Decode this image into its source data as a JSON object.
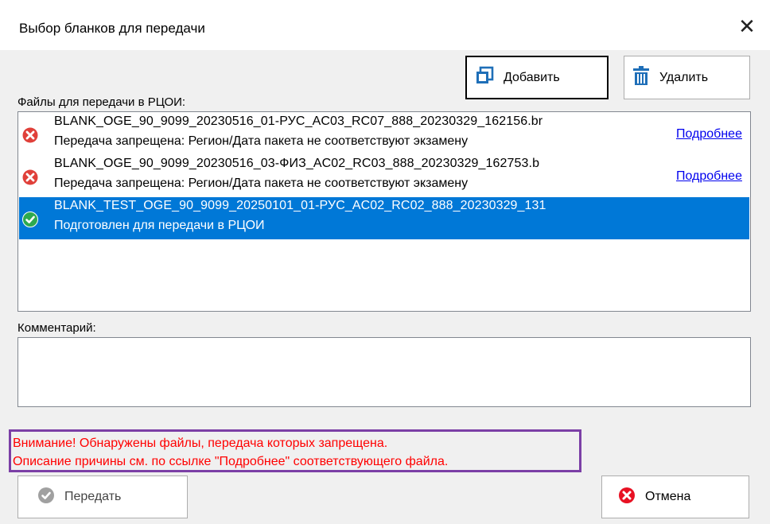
{
  "window": {
    "title": "Выбор бланков для передачи",
    "close_glyph": "✕"
  },
  "toolbar": {
    "add_label": "Добавить",
    "add_icon": "copy-icon",
    "delete_label": "Удалить",
    "delete_icon": "trash-icon"
  },
  "files": {
    "label": "Файлы для передачи в РЦОИ:",
    "items": [
      {
        "name": "BLANK_OGE_90_9099_20230516_01-РУС_AC03_RC07_888_20230329_162156.br",
        "status": "Передача запрещена: Регион/Дата пакета не соответствуют экзамену",
        "state": "error",
        "more_label": "Подробнее"
      },
      {
        "name": "BLANK_OGE_90_9099_20230516_03-ФИЗ_AC02_RC03_888_20230329_162753.b",
        "status": "Передача запрещена: Регион/Дата пакета не соответствуют экзамену",
        "state": "error",
        "more_label": "Подробнее"
      },
      {
        "name": "BLANK_TEST_OGE_90_9099_20250101_01-РУС_AC02_RC02_888_20230329_131",
        "status": "Подготовлен для передачи в РЦОИ",
        "state": "ok",
        "selected": true
      }
    ]
  },
  "comment": {
    "label": "Комментарий:",
    "value": ""
  },
  "warning": {
    "line1": "Внимание! Обнаружены файлы, передача которых запрещена.",
    "line2": "Описание причины см. по ссылке \"Подробнее\" соответствующего файла."
  },
  "footer": {
    "send_label": "Передать",
    "cancel_label": "Отмена"
  },
  "colors": {
    "selection": "#0078d7",
    "error": "#e81123",
    "ok": "#2da94f",
    "warning_text": "#ff0000",
    "warning_border": "#7b3fa6",
    "link": "#0000ee"
  }
}
